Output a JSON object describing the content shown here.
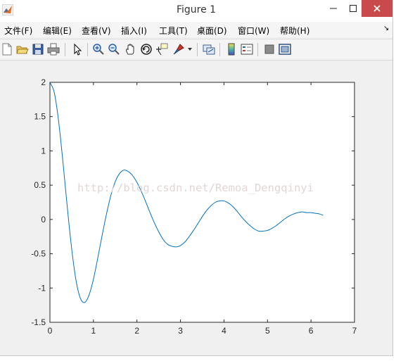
{
  "window": {
    "title": "Figure 1"
  },
  "menu": {
    "items": [
      "文件(F)",
      "编辑(E)",
      "查看(V)",
      "插入(I)",
      "工具(T)",
      "桌面(D)",
      "窗口(W)",
      "帮助(H)"
    ],
    "overflow_arrow": "↘"
  },
  "toolbar": {
    "icons": [
      "new-figure-icon",
      "open-file-icon",
      "save-icon",
      "print-icon",
      "select-arrow-icon",
      "zoom-in-icon",
      "zoom-out-icon",
      "pan-hand-icon",
      "rotate-3d-icon",
      "data-cursor-icon",
      "brush-icon",
      "link-plot-icon",
      "colorbar-icon",
      "legend-icon",
      "hide-plot-tools-icon",
      "show-plot-tools-icon"
    ]
  },
  "watermark": "http://blog.csdn.net/Remoa_Dengqinyi",
  "colors": {
    "line": "#0072bd",
    "close_button": "#c84a4a",
    "figure_bg": "#f0f0f0"
  },
  "chart_data": {
    "type": "line",
    "title": "",
    "xlabel": "",
    "ylabel": "",
    "xlim": [
      0,
      7
    ],
    "ylim": [
      -1.5,
      2
    ],
    "xticks": [
      0,
      1,
      2,
      3,
      4,
      5,
      6,
      7
    ],
    "yticks": [
      2,
      1.5,
      1,
      0.5,
      0,
      -0.5,
      -1,
      -1.5
    ],
    "xtick_labels": [
      "0",
      "1",
      "2",
      "3",
      "4",
      "5",
      "6",
      "7"
    ],
    "ytick_labels": [
      "2",
      "1.5",
      "1",
      "0.5",
      "0",
      "-0.5",
      "-1",
      "-1.5"
    ],
    "grid": false,
    "series": [
      {
        "x": [
          0.0,
          0.1,
          0.2,
          0.3,
          0.4,
          0.5,
          0.6,
          0.7,
          0.8,
          0.9,
          1.0,
          1.1,
          1.2,
          1.3,
          1.4,
          1.5,
          1.6,
          1.7,
          1.8,
          1.9,
          2.0,
          2.1,
          2.2,
          2.3,
          2.4,
          2.5,
          2.6,
          2.7,
          2.8,
          2.9,
          3.0,
          3.1,
          3.2,
          3.3,
          3.4,
          3.5,
          3.6,
          3.7,
          3.8,
          3.9,
          4.0,
          4.1,
          4.2,
          4.3,
          4.4,
          4.5,
          4.6,
          4.7,
          4.8,
          4.9,
          5.0,
          5.1,
          5.2,
          5.3,
          5.4,
          5.5,
          5.6,
          5.7,
          5.8,
          5.9,
          6.0,
          6.1,
          6.2,
          6.28
        ],
        "y": [
          2.0,
          1.85,
          1.43,
          0.83,
          0.17,
          -0.43,
          -0.89,
          -1.15,
          -1.21,
          -1.1,
          -0.87,
          -0.56,
          -0.23,
          0.08,
          0.35,
          0.55,
          0.67,
          0.72,
          0.7,
          0.64,
          0.54,
          0.41,
          0.26,
          0.1,
          -0.05,
          -0.18,
          -0.29,
          -0.36,
          -0.39,
          -0.4,
          -0.38,
          -0.33,
          -0.25,
          -0.16,
          -0.06,
          0.04,
          0.13,
          0.2,
          0.25,
          0.27,
          0.27,
          0.24,
          0.19,
          0.12,
          0.04,
          -0.03,
          -0.09,
          -0.14,
          -0.17,
          -0.17,
          -0.16,
          -0.13,
          -0.09,
          -0.04,
          0.01,
          0.05,
          0.08,
          0.1,
          0.11,
          0.1,
          0.1,
          0.09,
          0.08,
          0.06
        ]
      }
    ]
  }
}
